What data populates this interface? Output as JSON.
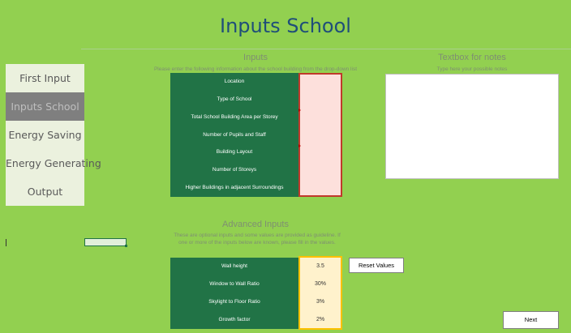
{
  "page": {
    "title": "Inputs School"
  },
  "sidebar": {
    "items": [
      {
        "label": "First Input"
      },
      {
        "label": "Inputs School"
      },
      {
        "label": "Energy Saving"
      },
      {
        "label": "Energy Generating"
      },
      {
        "label": "Output"
      }
    ],
    "active_index": 1
  },
  "inputs": {
    "title": "Inputs",
    "subtitle": "Please enter the following information about the school building from the drop-down list",
    "fields": [
      {
        "label": "Location",
        "value": ""
      },
      {
        "label": "Type of School",
        "value": ""
      },
      {
        "label": "Total School Building Area per Storey",
        "value": ""
      },
      {
        "label": "Number of Pupils and Staff",
        "value": ""
      },
      {
        "label": "Building Layout",
        "value": ""
      },
      {
        "label": "Number of Storeys",
        "value": ""
      },
      {
        "label": "Higher Buildings in adjacent Surroundings",
        "value": ""
      }
    ]
  },
  "notes": {
    "title": "Textbox for notes",
    "subtitle": "Type here your possible notes",
    "value": ""
  },
  "advanced": {
    "title": "Advanced Inputs",
    "subtitle": "These are optional inputs and some values are provided as guideline. If one or more of the inputs below are known, please fill in the values.",
    "fields": [
      {
        "label": "Wall height",
        "value": "3.5"
      },
      {
        "label": "Window to Wall Ratio",
        "value": "30%"
      },
      {
        "label": "Skylight to Floor Ratio",
        "value": "3%"
      },
      {
        "label": "Growth factor",
        "value": "2%"
      }
    ],
    "reset_label": "Reset Values"
  },
  "navigation": {
    "next_label": "Next"
  },
  "colors": {
    "background": "#92d050",
    "label_fill": "#217346",
    "input_fill": "#fde0dc",
    "input_border": "#c0392b",
    "advanced_fill": "#fff2cc",
    "advanced_border": "#ffc000",
    "active_nav": "#7f7f7f"
  }
}
